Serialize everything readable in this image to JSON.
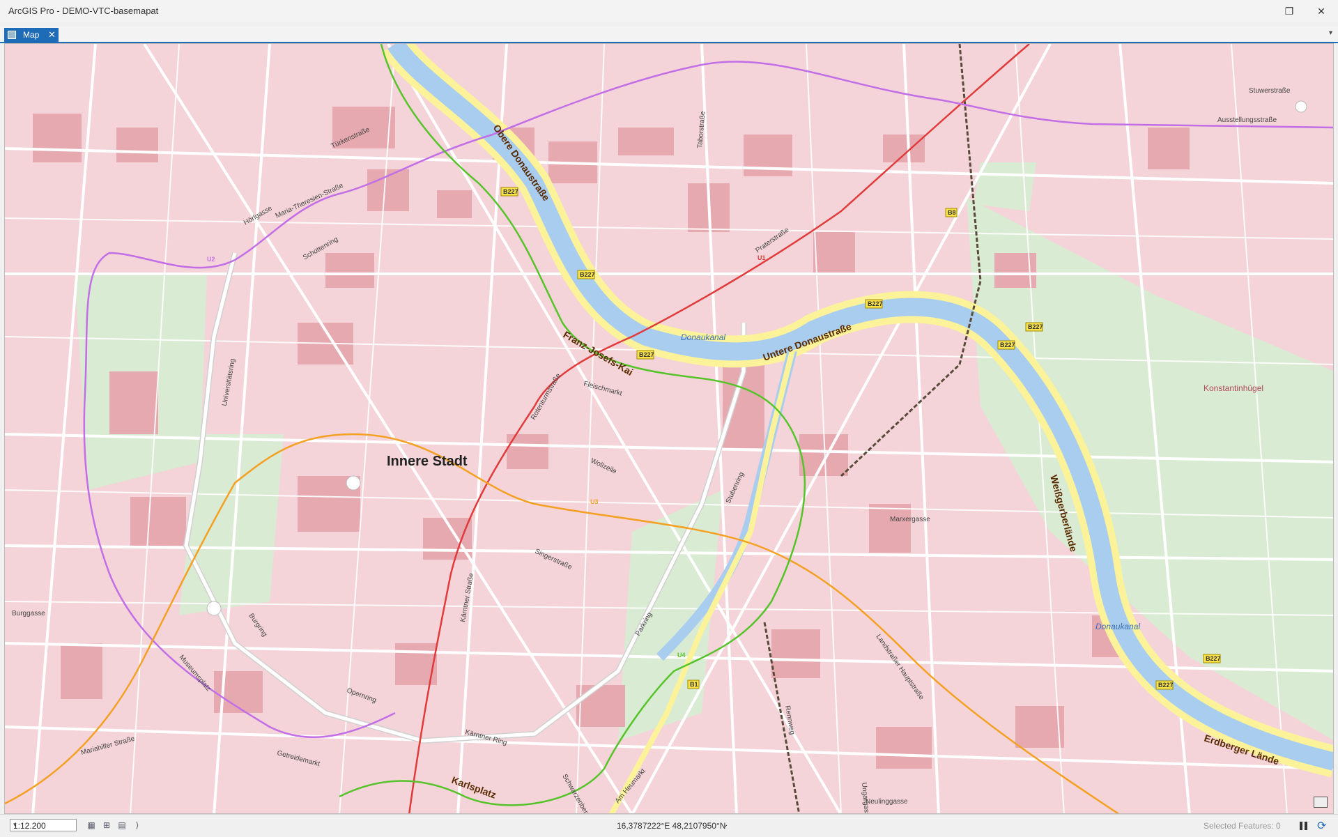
{
  "window": {
    "title": "ArcGIS Pro - DEMO-VTC-basemapat",
    "restore_glyph": "❐",
    "close_glyph": "✕"
  },
  "tabs": [
    {
      "label": "Map",
      "icon": "map-icon",
      "close_glyph": "✕"
    }
  ],
  "tab_menu_glyph": "▾",
  "map": {
    "district_label": "Innere Stadt",
    "street_labels": [
      "Obere Donaustraße",
      "Franz-Josefs-Kai",
      "Untere Donaustraße",
      "Weißgerberlände",
      "Erdberger Lände",
      "Karlsplatz",
      "Schottenring",
      "Maria-Theresien-Straße",
      "Universitätsring",
      "Burgring",
      "Opernring",
      "Kärntner Ring",
      "Museumsplatz",
      "Getreidemarkt",
      "Parkring",
      "Stubenring",
      "Landstraßer Hauptstraße",
      "Ausstellungsstraße",
      "Praterstraße",
      "Taborstraße",
      "Türkenstraße",
      "Hörlgasse",
      "Kärntner Straße",
      "Singerstraße",
      "Burggasse",
      "Mariahilfer Straße",
      "Schwarzenbergplatz",
      "Am Heumarkt",
      "Ungargasse",
      "Rennweg",
      "Rotenturmstraße",
      "Fleischmarkt",
      "Wollzeile",
      "Stuwerstraße",
      "Neulinggasse",
      "Marxergasse"
    ],
    "water_labels": [
      "Donaukanal",
      "Donaukanal"
    ],
    "poi_labels": [
      "Konstantinhügel"
    ],
    "road_shields": [
      "B227",
      "B227",
      "B227",
      "B227",
      "B227",
      "B227",
      "B227",
      "B227",
      "B8",
      "B1"
    ],
    "line_labels": [
      "U1",
      "U2",
      "U3",
      "U4"
    ],
    "colors": {
      "blocks": "#f4d4d8",
      "buildings": "#e6a9b0",
      "streets": "#ffffff",
      "major_road": "#fbf29a",
      "water": "#a8cdee",
      "park": "#d9ebd2",
      "u1_line": "#e03a3a",
      "u2_line": "#c26ee6",
      "u3_line": "#f4a022",
      "u4_line": "#56c32a",
      "rail": "#5a4a3a"
    }
  },
  "statusbar": {
    "scale": "1:12.200",
    "scale_dropdown_glyph": "▾",
    "coordinates": "16,3787222°E 48,2107950°N",
    "coordinates_dropdown_glyph": "⌄",
    "selected_features": "Selected Features: 0",
    "refresh_glyph": "⟳"
  }
}
